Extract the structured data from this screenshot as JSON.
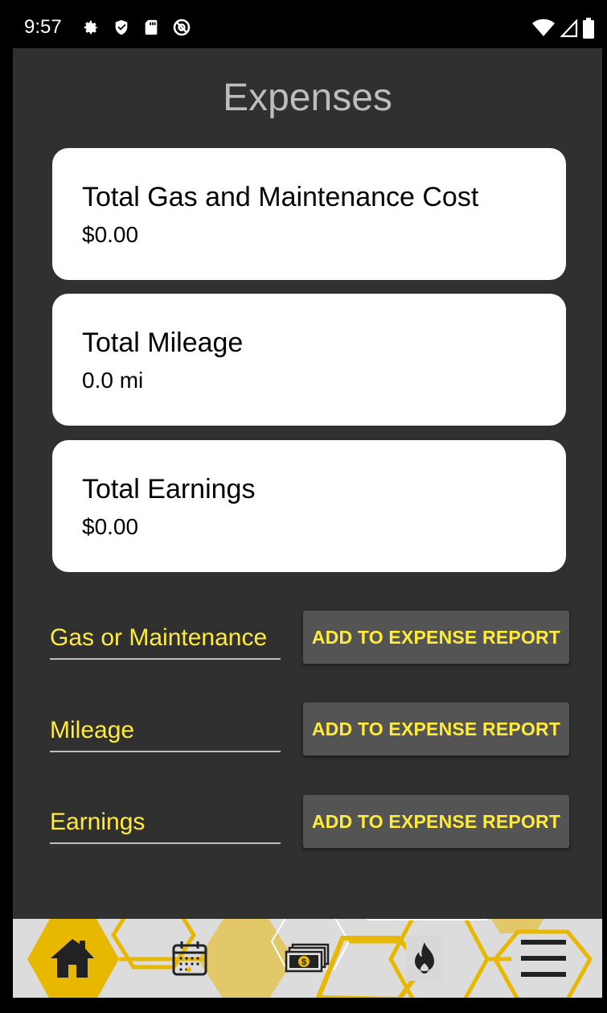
{
  "status_bar": {
    "time": "9:57",
    "left_icons": [
      "gear-icon",
      "shield-icon",
      "sd-card-icon",
      "at-icon"
    ],
    "right_icons": [
      "wifi-icon",
      "signal-icon",
      "battery-icon"
    ]
  },
  "page": {
    "title": "Expenses"
  },
  "cards": [
    {
      "title": "Total Gas and Maintenance Cost",
      "value": "$0.00"
    },
    {
      "title": "Total Mileage",
      "value": "0.0 mi"
    },
    {
      "title": "Total Earnings",
      "value": "$0.00"
    }
  ],
  "entries": [
    {
      "placeholder": "Gas or Maintenance",
      "value": "",
      "button_label": "ADD TO EXPENSE REPORT"
    },
    {
      "placeholder": "Mileage",
      "value": "",
      "button_label": "ADD TO EXPENSE REPORT"
    },
    {
      "placeholder": "Earnings",
      "value": "",
      "button_label": "ADD TO EXPENSE REPORT"
    }
  ],
  "nav": {
    "items": [
      "home-icon",
      "calendar-icon",
      "money-icon",
      "fire-icon",
      "menu-icon"
    ]
  },
  "colors": {
    "screen_bg": "#303030",
    "accent_yellow": "#ffeb3b",
    "honeycomb_gold": "#e8b800",
    "button_bg": "#545454",
    "title_gray": "#bdbdbd"
  }
}
